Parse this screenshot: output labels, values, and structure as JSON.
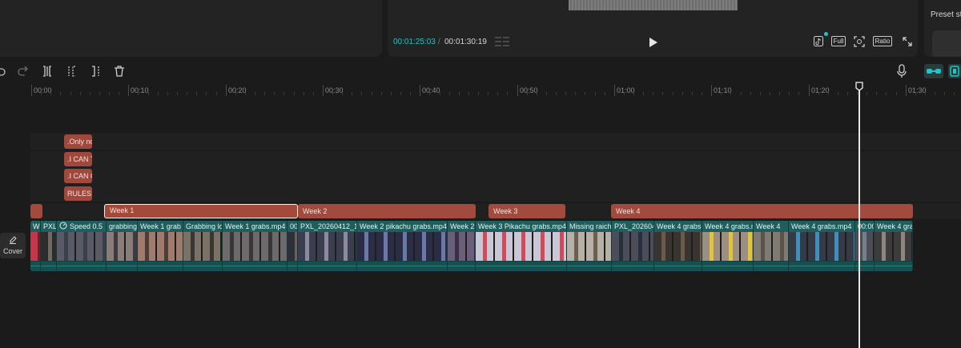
{
  "player": {
    "current_time": "00:01:25:03",
    "separator": "/",
    "total_time": "00:01:30:19",
    "accent_color": "#1fc6c6",
    "tools": {
      "tiktok_icon": "tiktok-icon",
      "full_label": "Full",
      "fit_icon": "focus-icon",
      "ratio_label": "Ratio",
      "fullscreen_icon": "fullscreen-icon"
    }
  },
  "right_panel": {
    "preset_text": "Preset st"
  },
  "toolbar": {
    "icons": [
      "undo-icon",
      "redo-icon",
      "split-icon",
      "split-left-icon",
      "split-right-icon",
      "delete-icon"
    ],
    "right_icons": [
      "microphone-icon",
      "link-icon",
      "magnet-icon"
    ]
  },
  "ruler": {
    "labels": [
      "00:00",
      "00:10",
      "00:20",
      "00:30",
      "00:40",
      "00:50",
      "01:00",
      "01:10",
      "01:20",
      "01:30"
    ]
  },
  "text_clips": [
    ".Only no",
    ".I CAN T",
    ".I CAN G",
    "RULES:"
  ],
  "week_clips": [
    "",
    "Week 1",
    "Week 2",
    "Week 3",
    "Week 4"
  ],
  "video_clips": [
    "W",
    "PXL",
    "Speed 0.5",
    "grabbing",
    "Week 1 grab",
    "Grabbing lo",
    "Week 1 grabs.mp4",
    "00",
    "PXL_20260412_18",
    "Week 2 pikachu grabs.mp4",
    "Week 2",
    "Week 3 Pikachu grabs.mp4",
    "Missing raich",
    "PXL_202604",
    "Week 4 grabs",
    "Week 4 grabs.mp4",
    "Week 4",
    "Week 4 grabs.mp4",
    "00:00",
    "Week 4 gra"
  ],
  "cover": {
    "label": "Cover"
  },
  "playhead": {
    "time": "01:25"
  }
}
